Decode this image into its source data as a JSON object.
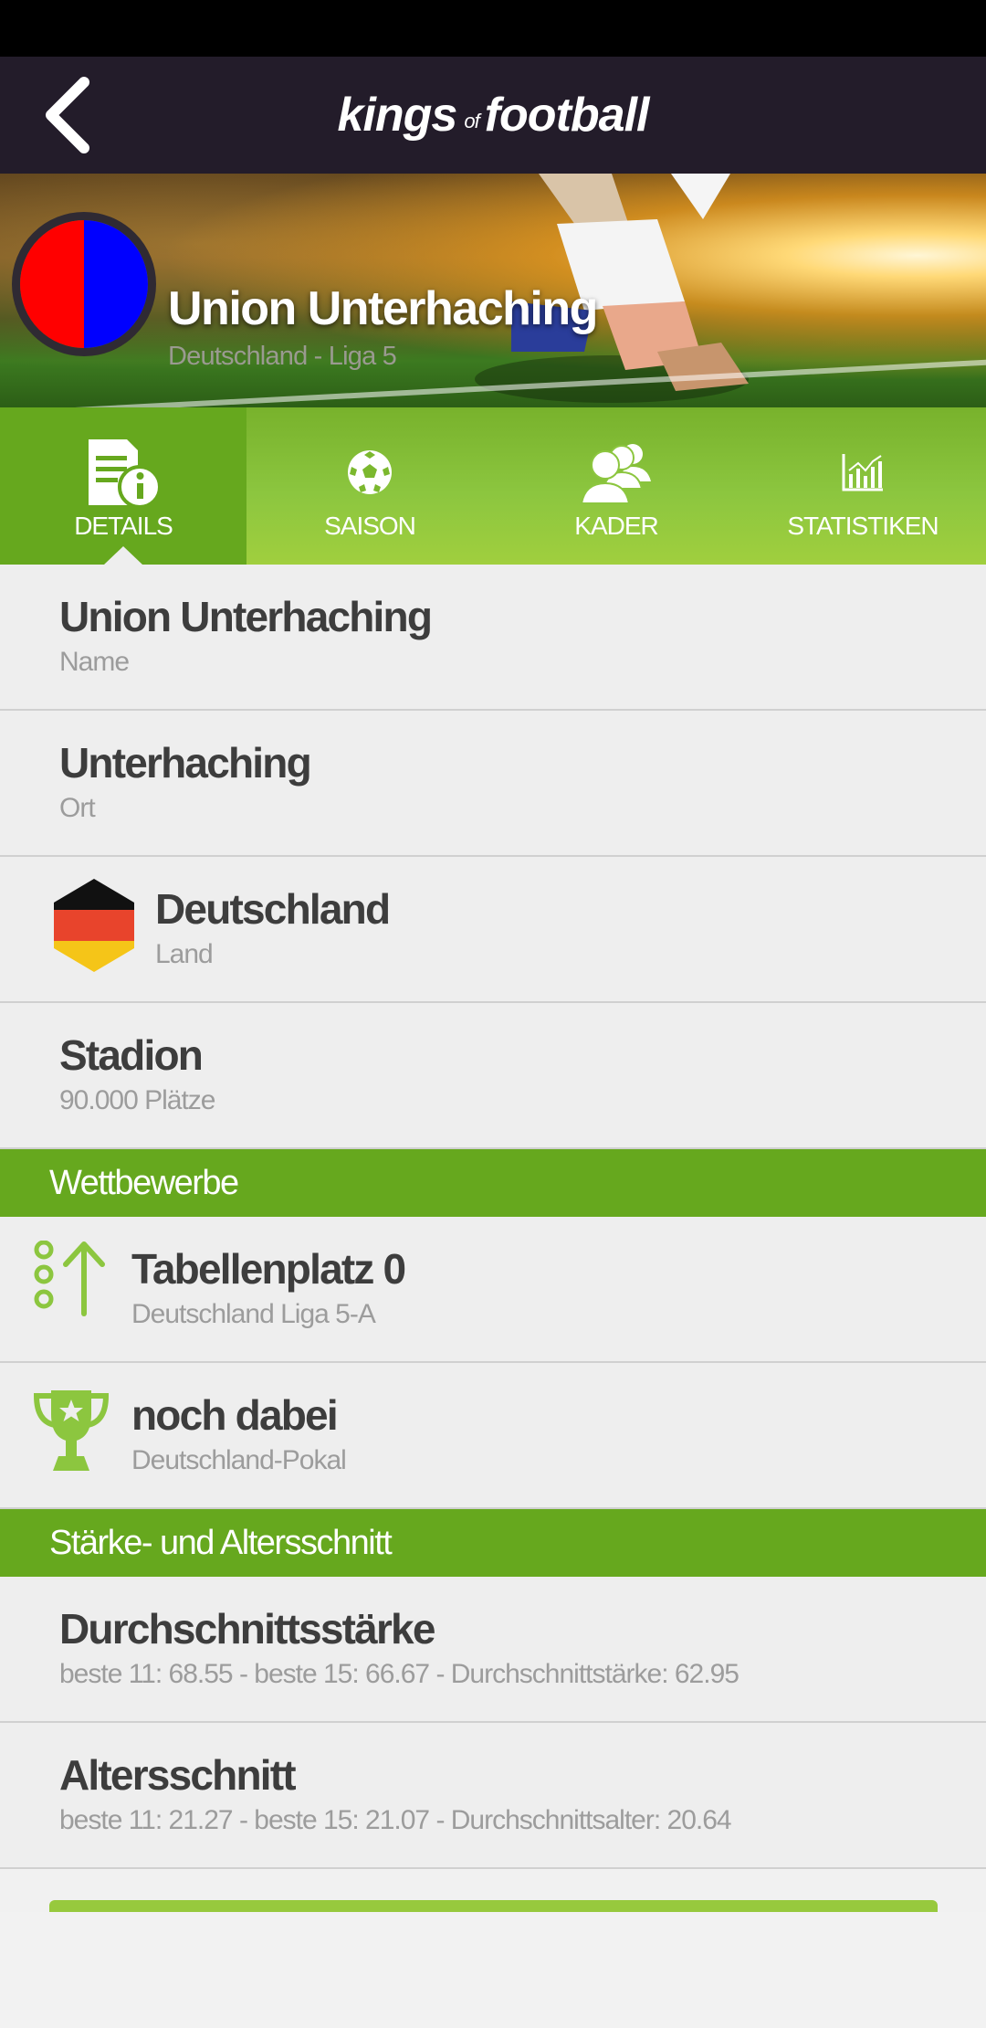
{
  "header": {
    "logo_part1": "kings",
    "logo_part2": "of",
    "logo_part3": "football"
  },
  "club": {
    "name": "Union Unterhaching",
    "league": "Deutschland - Liga 5",
    "colors": [
      "#ff0000",
      "#0000ff"
    ]
  },
  "tabs": [
    {
      "label": "DETAILS",
      "icon": "document-info-icon",
      "active": true
    },
    {
      "label": "SAISON",
      "icon": "soccer-ball-icon",
      "active": false
    },
    {
      "label": "KADER",
      "icon": "people-icon",
      "active": false
    },
    {
      "label": "STATISTIKEN",
      "icon": "chart-icon",
      "active": false
    }
  ],
  "details": [
    {
      "title": "Union Unterhaching",
      "sub": "Name"
    },
    {
      "title": "Unterhaching",
      "sub": "Ort"
    },
    {
      "title": "Deutschland",
      "sub": "Land",
      "icon": "germany-flag-icon"
    },
    {
      "title": "Stadion",
      "sub": "90.000 Plätze"
    }
  ],
  "sections": {
    "competitions": "Wettbewerbe",
    "strength": "Stärke- und Altersschnitt"
  },
  "competitions": [
    {
      "title": "Tabellenplatz 0",
      "sub": "Deutschland Liga 5-A",
      "icon": "table-rank-up-icon"
    },
    {
      "title": "noch dabei",
      "sub": "Deutschland-Pokal",
      "icon": "trophy-icon"
    }
  ],
  "strength": [
    {
      "title": "Durchschnittsstärke",
      "sub": "beste 11: 68.55 - beste 15: 66.67 - Durchschnittstärke: 62.95"
    },
    {
      "title": "Altersschnitt",
      "sub": "beste 11: 21.27 - beste 15: 21.07 - Durchschnittsalter: 20.64"
    }
  ],
  "theme": {
    "accent": "#66a81e",
    "header_bg": "#231c2a",
    "icon_green": "#8cc63f"
  }
}
